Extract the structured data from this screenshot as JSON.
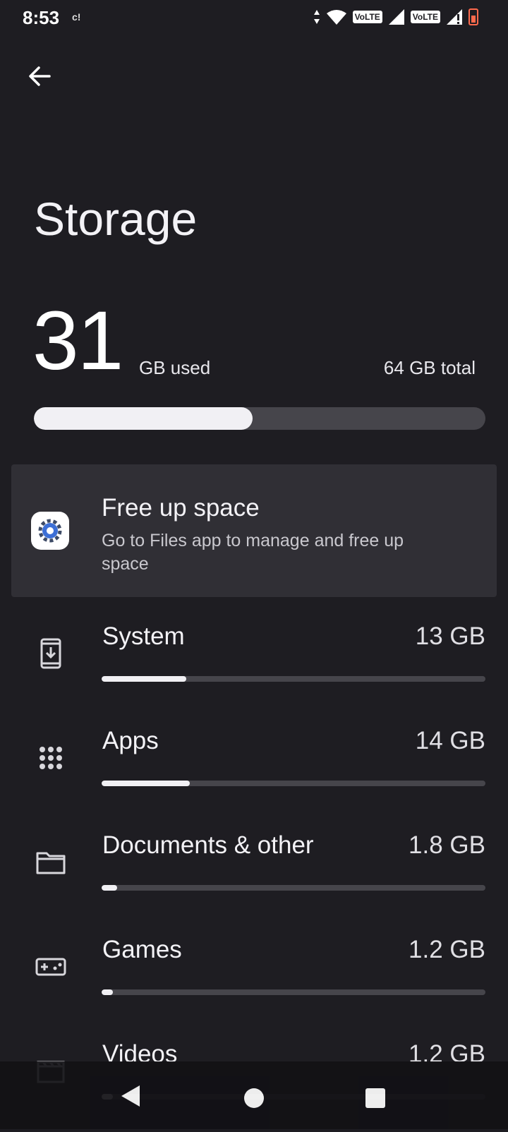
{
  "status_bar": {
    "time": "8:53",
    "small_indicator": "c!",
    "volte_1": "VoLTE",
    "volte_2": "VoLTE"
  },
  "header": {
    "title": "Storage"
  },
  "summary": {
    "used_value": "31",
    "used_unit": "GB used",
    "total_label": "64 GB total",
    "used_fraction": 0.484
  },
  "free_up": {
    "title": "Free up space",
    "subtitle": "Go to Files app to manage and free up space"
  },
  "categories": [
    {
      "label": "System",
      "value": "13 GB",
      "fraction": 0.22,
      "icon": "system-update-icon"
    },
    {
      "label": "Apps",
      "value": "14 GB",
      "fraction": 0.23,
      "icon": "apps-grid-icon"
    },
    {
      "label": "Documents & other",
      "value": "1.8 GB",
      "fraction": 0.04,
      "icon": "folder-icon"
    },
    {
      "label": "Games",
      "value": "1.2 GB",
      "fraction": 0.03,
      "icon": "gamepad-icon"
    },
    {
      "label": "Videos",
      "value": "1.2 GB",
      "fraction": 0.03,
      "icon": "clapperboard-icon"
    }
  ],
  "colors": {
    "background": "#1e1d22",
    "card": "#302f35",
    "bar_track": "#46454b",
    "bar_fill": "#f1f0f4",
    "battery": "#ff6a4d"
  }
}
